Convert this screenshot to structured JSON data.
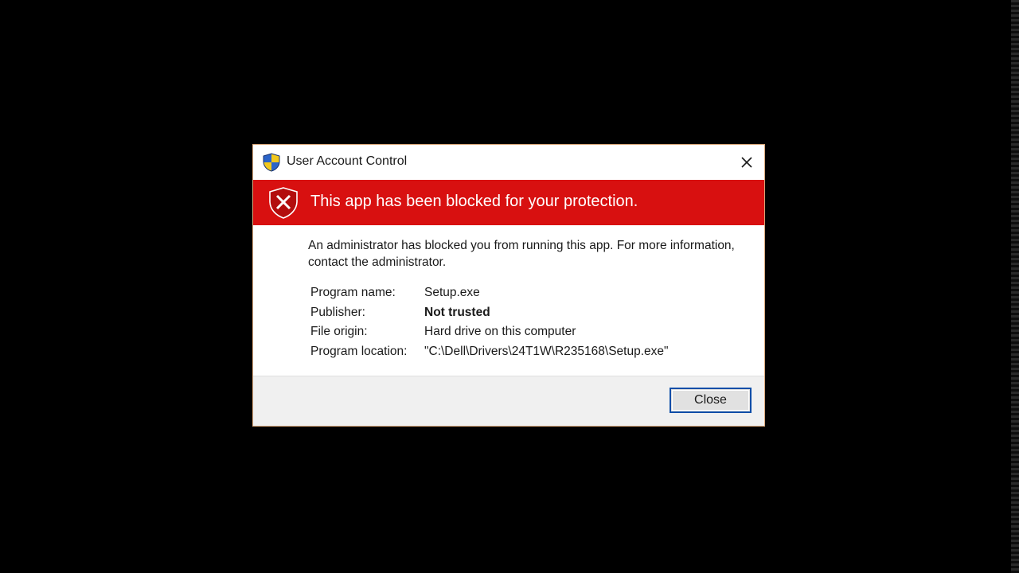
{
  "dialog": {
    "title": "User Account Control",
    "close_icon": "close-icon",
    "title_icon": "uac-shield-icon"
  },
  "banner": {
    "text": "This app has been blocked for your protection.",
    "icon": "blocked-shield-icon",
    "background_color": "#d81010"
  },
  "message": {
    "text": "An administrator has blocked you from running this app. For more information, contact the administrator."
  },
  "details": {
    "rows": [
      {
        "label": "Program name:",
        "value": "Setup.exe"
      },
      {
        "label": "Publisher:",
        "value": "Not trusted"
      },
      {
        "label": "File origin:",
        "value": "Hard drive on this computer"
      },
      {
        "label": "Program location:",
        "value": "\"C:\\Dell\\Drivers\\24T1W\\R235168\\Setup.exe\""
      }
    ]
  },
  "footer": {
    "close_label": "Close",
    "accent_color": "#0b4ea8"
  }
}
